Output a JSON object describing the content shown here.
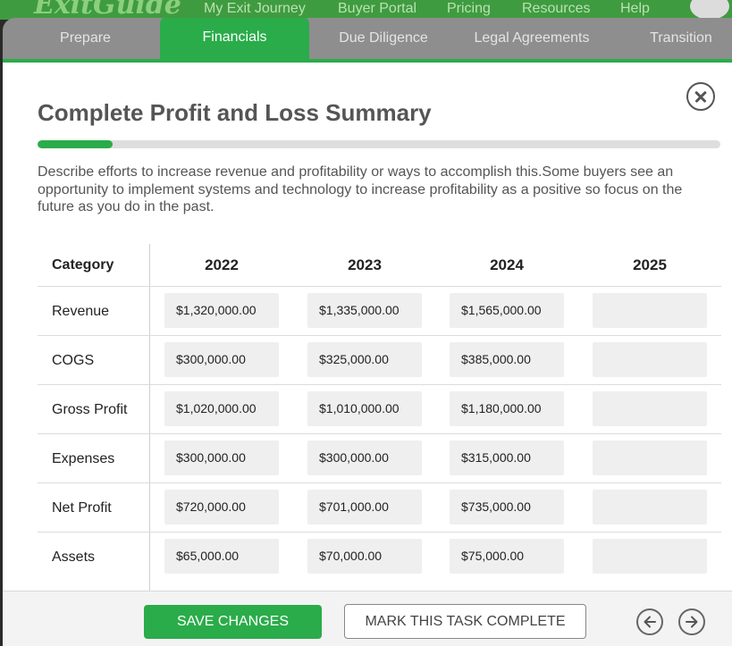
{
  "top_nav": {
    "logo": "ExitGuide",
    "links": [
      "My Exit Journey",
      "Buyer Portal",
      "Pricing",
      "Resources",
      "Help"
    ]
  },
  "tabs": [
    {
      "label": "Prepare",
      "active": false
    },
    {
      "label": "Financials",
      "active": true
    },
    {
      "label": "Due Diligence",
      "active": false
    },
    {
      "label": "Legal Agreements",
      "active": false
    },
    {
      "label": "Transition",
      "active": false
    }
  ],
  "modal": {
    "title": "Complete Profit and Loss Summary",
    "progress_fraction": 0.11,
    "description": "Describe efforts to increase revenue and profitability or ways to accomplish this.Some buyers see an opportunity to implement systems and technology to increase profitability as a positive so focus on the future as you do in the past."
  },
  "table": {
    "category_header": "Category",
    "years": [
      "2022",
      "2023",
      "2024",
      "2025"
    ],
    "rows": [
      {
        "category": "Revenue",
        "values": [
          "$1,320,000.00",
          "$1,335,000.00",
          "$1,565,000.00",
          ""
        ]
      },
      {
        "category": "COGS",
        "values": [
          "$300,000.00",
          "$325,000.00",
          "$385,000.00",
          ""
        ]
      },
      {
        "category": "Gross Profit",
        "values": [
          "$1,020,000.00",
          "$1,010,000.00",
          "$1,180,000.00",
          ""
        ]
      },
      {
        "category": "Expenses",
        "values": [
          "$300,000.00",
          "$300,000.00",
          "$315,000.00",
          ""
        ]
      },
      {
        "category": "Net Profit",
        "values": [
          "$720,000.00",
          "$701,000.00",
          "$735,000.00",
          ""
        ]
      },
      {
        "category": "Assets",
        "values": [
          "$65,000.00",
          "$70,000.00",
          "$75,000.00",
          ""
        ]
      }
    ]
  },
  "footer": {
    "save_label": "SAVE CHANGES",
    "complete_label": "MARK THIS TASK COMPLETE"
  },
  "colors": {
    "accent_green": "#2aac4a",
    "nav_green": "#3f9b40",
    "cell_bg": "#efefef"
  }
}
